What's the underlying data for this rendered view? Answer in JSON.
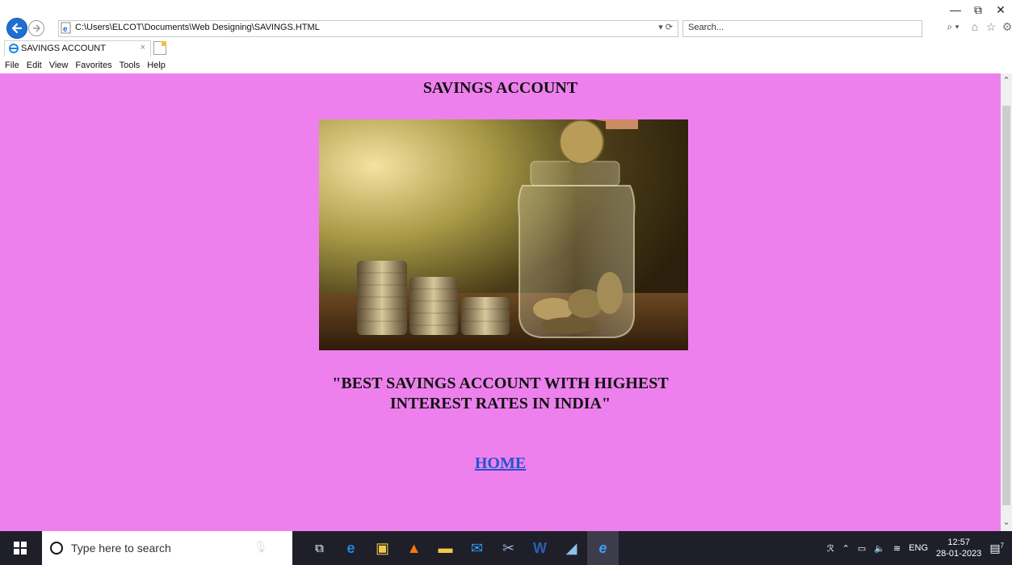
{
  "browser": {
    "address": "C:\\Users\\ELCOT\\Documents\\Web Designing\\SAVINGS.HTML",
    "address_controls": "▾ ⟳",
    "search_placeholder": "Search...",
    "search_icon_label": "⌕ ▾",
    "tab_title": "SAVINGS ACCOUNT",
    "tab_close": "×",
    "window_minimize": "—",
    "window_restore": "⧉",
    "window_close": "✕"
  },
  "menu": [
    "File",
    "Edit",
    "View",
    "Favorites",
    "Tools",
    "Help"
  ],
  "page": {
    "title": "SAVINGS ACCOUNT",
    "tagline_line1": "\"BEST SAVINGS ACCOUNT WITH HIGHEST",
    "tagline_line2": "INTEREST RATES IN INDIA\"",
    "home_link": "HOME"
  },
  "taskbar": {
    "search_placeholder": "Type here to search",
    "language": "ENG",
    "time": "12:57",
    "date": "28-01-2023",
    "notification_count": "7"
  },
  "colors": {
    "page_background": "#ee80ee",
    "link": "#2255cc",
    "taskbar": "#1f1f2a"
  }
}
